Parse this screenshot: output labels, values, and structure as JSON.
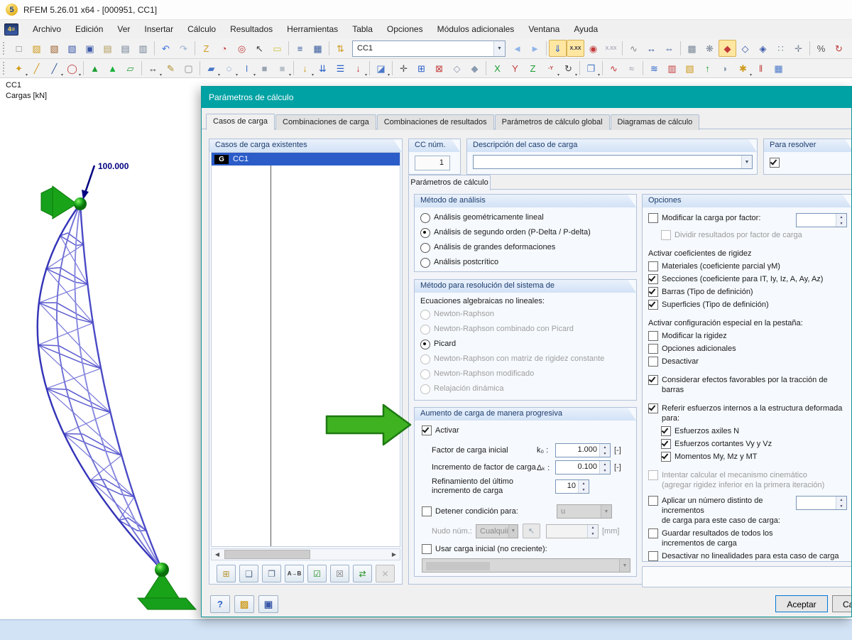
{
  "window": {
    "title": "RFEM 5.26.01 x64 - [000951, CC1]"
  },
  "menubar": {
    "items": [
      {
        "n": "menu-archivo",
        "label": "Archivo"
      },
      {
        "n": "menu-edicion",
        "label": "Edición"
      },
      {
        "n": "menu-ver",
        "label": "Ver"
      },
      {
        "n": "menu-insertar",
        "label": "Insertar"
      },
      {
        "n": "menu-calculo",
        "label": "Cálculo"
      },
      {
        "n": "menu-resultados",
        "label": "Resultados"
      },
      {
        "n": "menu-herramientas",
        "label": "Herramientas"
      },
      {
        "n": "menu-tabla",
        "label": "Tabla"
      },
      {
        "n": "menu-opciones",
        "label": "Opciones"
      },
      {
        "n": "menu-modulos-adicionales",
        "label": "Módulos adicionales"
      },
      {
        "n": "menu-ventana",
        "label": "Ventana"
      },
      {
        "n": "menu-ayuda",
        "label": "Ayuda"
      }
    ]
  },
  "toolbar1": {
    "combo_value": "CC1",
    "icons_before": [
      {
        "n": "new-model",
        "g": "□",
        "c": "#777"
      },
      {
        "n": "open-model",
        "g": "▨",
        "c": "#cf9b1c"
      },
      {
        "n": "open-project",
        "g": "▧",
        "c": "#a0622d"
      },
      {
        "n": "open-connection",
        "g": "▧",
        "c": "#3a58a8"
      },
      {
        "n": "save-model",
        "g": "▣",
        "c": "#3a58a8"
      },
      {
        "n": "clipboard",
        "g": "▤",
        "c": "#b09a5a"
      },
      {
        "n": "print",
        "g": "▤",
        "c": "#6f7f93"
      },
      {
        "n": "print-preview",
        "g": "▥",
        "c": "#6f7f93"
      },
      {
        "s": 1
      },
      {
        "n": "undo",
        "g": "↶",
        "c": "#3a6fd8"
      },
      {
        "n": "redo",
        "g": "↷",
        "c": "#9ab0d0"
      },
      {
        "s": 1
      },
      {
        "n": "new-polyline",
        "g": "Z",
        "c": "#cf9b1c"
      },
      {
        "n": "new-arc",
        "g": "◔",
        "c": "#c23b3b"
      },
      {
        "n": "new-circle",
        "g": "◎",
        "c": "#c23b3b"
      },
      {
        "n": "select-objects",
        "g": "↖",
        "c": "#444"
      },
      {
        "n": "new-block",
        "g": "▭",
        "c": "#cfc23a"
      },
      {
        "s": 1
      },
      {
        "n": "navigator-toggle",
        "g": "≡",
        "c": "#35599a"
      },
      {
        "n": "tables-toggle",
        "g": "▦",
        "c": "#35599a"
      },
      {
        "s": 1
      },
      {
        "n": "load-case-nav",
        "g": "⇅",
        "c": "#cf9b1c"
      }
    ],
    "icons_after": [
      {
        "n": "previous-load-case",
        "g": "◄",
        "c": "#8fb4e8"
      },
      {
        "n": "next-load-case",
        "g": "►",
        "c": "#8fb4e8"
      },
      {
        "s": 1
      },
      {
        "n": "show-loads",
        "g": "⇓",
        "c": "#2a62c8",
        "p": 1
      },
      {
        "n": "show-load-values",
        "g": "X.XX",
        "c": "#334",
        "p": 1,
        "sm": 1
      },
      {
        "n": "show-supports",
        "g": "◉",
        "c": "#c23b3b"
      },
      {
        "n": "show-result-values",
        "g": "X.XX",
        "c": "#aab",
        "sm": 1
      },
      {
        "s": 1
      },
      {
        "n": "member-couplings",
        "g": "∿",
        "c": "#8a8a8a"
      },
      {
        "n": "guide-lines",
        "g": "↔",
        "c": "#35599a"
      },
      {
        "n": "dimensions",
        "g": "⇔",
        "c": "#35599a"
      },
      {
        "s": 1
      },
      {
        "n": "fe-mesh",
        "g": "▩",
        "c": "#7d8a99"
      },
      {
        "n": "fe-mesh-settings",
        "g": "❋",
        "c": "#7d8a99"
      },
      {
        "n": "work-plane",
        "g": "◆",
        "c": "#c23b3b",
        "p": 1
      },
      {
        "n": "work-plane-xy",
        "g": "◇",
        "c": "#3a58a8"
      },
      {
        "n": "work-plane-xz",
        "g": "◈",
        "c": "#3a58a8"
      },
      {
        "n": "grid-points",
        "g": "∷",
        "c": "#7d8a99"
      },
      {
        "n": "snap-settings",
        "g": "✛",
        "c": "#7d8a99"
      },
      {
        "s": 1
      },
      {
        "n": "select-via-line",
        "g": "%",
        "c": "#555"
      },
      {
        "n": "rotate-copy",
        "g": "↻",
        "c": "#c23b3b"
      },
      {
        "n": "mirror-copy",
        "g": "⋈",
        "c": "#35599a"
      },
      {
        "n": "delete-objects",
        "g": "✕",
        "c": "#c23b3b"
      },
      {
        "n": "object-info",
        "g": "ⓘ",
        "c": "#2a62c8"
      },
      {
        "n": "display-properties",
        "g": "❏",
        "c": "#6f7f93"
      },
      {
        "n": "program-options",
        "g": "✱",
        "c": "#6f7f93"
      }
    ]
  },
  "toolbar2": {
    "icons": [
      {
        "n": "insert-node",
        "g": "✦",
        "c": "#cf9b1c",
        "d": 1
      },
      {
        "n": "insert-line",
        "g": "╱",
        "c": "#cf9b1c"
      },
      {
        "n": "insert-member",
        "g": "╱",
        "c": "#35599a",
        "d": 1
      },
      {
        "n": "insert-circle",
        "g": "◯",
        "c": "#c23b3b",
        "d": 1
      },
      {
        "s": 1
      },
      {
        "n": "nodal-support",
        "g": "▲",
        "c": "#1d9e33"
      },
      {
        "n": "line-support",
        "g": "▲",
        "c": "#19b33c"
      },
      {
        "n": "surface-support",
        "g": "▱",
        "c": "#1d9e33"
      },
      {
        "s": 1
      },
      {
        "n": "dimension",
        "g": "↔",
        "c": "#444",
        "d": 1
      },
      {
        "n": "comment",
        "g": "✎",
        "c": "#b08c2a"
      },
      {
        "n": "select-box",
        "g": "▢",
        "c": "#888"
      },
      {
        "s": 1
      },
      {
        "n": "new-surface",
        "g": "▰",
        "c": "#4a78c8",
        "d": 1
      },
      {
        "n": "new-opening",
        "g": "◌",
        "c": "#4a78c8",
        "d": 1
      },
      {
        "n": "new-rib",
        "g": "I",
        "c": "#4a78c8",
        "d": 1
      },
      {
        "n": "new-solid",
        "g": "■",
        "c": "#9aa4b0"
      },
      {
        "n": "new-solid-via-surfaces",
        "g": "■",
        "c": "#b8c0ca",
        "d": 1
      },
      {
        "s": 1
      },
      {
        "n": "nodal-load",
        "g": "↓",
        "c": "#cf9b1c",
        "d": 1
      },
      {
        "n": "member-load",
        "g": "⇊",
        "c": "#2a62c8"
      },
      {
        "n": "surface-load",
        "g": "☰",
        "c": "#2a62c8"
      },
      {
        "n": "free-load",
        "g": "↓",
        "c": "#c23b3b",
        "d": 1
      },
      {
        "s": 1
      },
      {
        "n": "load-generation",
        "g": "◪",
        "c": "#4a78c8",
        "d": 1
      },
      {
        "s": 1
      },
      {
        "n": "special-selection",
        "g": "✛",
        "c": "#555"
      },
      {
        "n": "zoom-window",
        "g": "⊞",
        "c": "#2a62c8"
      },
      {
        "n": "zoom-out",
        "g": "⊠",
        "c": "#c23b3b"
      },
      {
        "n": "isometric-view",
        "g": "◇",
        "c": "#8a9ab0"
      },
      {
        "n": "perspective-view",
        "g": "◆",
        "c": "#8a9ab0"
      },
      {
        "s": 1
      },
      {
        "n": "view-x",
        "g": "X",
        "c": "#1d9e33"
      },
      {
        "n": "view-y",
        "g": "Y",
        "c": "#c23b3b"
      },
      {
        "n": "view-z",
        "g": "Z",
        "c": "#1d9e33"
      },
      {
        "n": "view-minus-y",
        "g": "-Y",
        "c": "#c23b3b",
        "d": 1,
        "sm": 1
      },
      {
        "n": "rotate-view",
        "g": "↻",
        "c": "#444",
        "d": 1
      },
      {
        "s": 1
      },
      {
        "n": "visibility-modes",
        "g": "❐",
        "c": "#4a78c8",
        "d": 1
      },
      {
        "s": 1
      },
      {
        "n": "show-deformation",
        "g": "∿",
        "c": "#c23b3b"
      },
      {
        "n": "panel-toggle",
        "g": "≈",
        "c": "#99a"
      },
      {
        "s": 1
      },
      {
        "n": "results-diagrams",
        "g": "≋",
        "c": "#2a62c8"
      },
      {
        "n": "color-panels",
        "g": "▥",
        "c": "#c23b3b"
      },
      {
        "n": "render-model",
        "g": "▧",
        "c": "#cf9b1c"
      },
      {
        "n": "deformed-shape",
        "g": "↑",
        "c": "#1d9e33"
      },
      {
        "n": "smooth-results",
        "g": "◗",
        "c": "#8a9ab0"
      },
      {
        "n": "result-values",
        "g": "✱",
        "c": "#cf9b1c",
        "d": 1
      },
      {
        "n": "sections",
        "g": "‖",
        "c": "#c23b3b"
      },
      {
        "n": "result-tables",
        "g": "▦",
        "c": "#4a78c8"
      }
    ]
  },
  "viewport": {
    "case_label": "CC1",
    "subtitle": "Cargas [kN]",
    "load_value": "100.000"
  },
  "dialog": {
    "title": "Parámetros de cálculo",
    "tabs": [
      {
        "n": "tab-casos-de-carga",
        "label": "Casos de carga",
        "active": 1
      },
      {
        "n": "tab-combinaciones-de-carga",
        "label": "Combinaciones de carga"
      },
      {
        "n": "tab-combinaciones-de-resultados",
        "label": "Combinaciones de resultados"
      },
      {
        "n": "tab-parametros-calculo-global",
        "label": "Parámetros de cálculo global"
      },
      {
        "n": "tab-diagramas-de-calculo",
        "label": "Diagramas de cálculo"
      }
    ],
    "cases_panel": {
      "header": "Casos de carga existentes",
      "badge": "G",
      "case_name": "CC1"
    },
    "case_buttons": [
      {
        "n": "new-load-case",
        "g": "⊞",
        "c": "#b8932e"
      },
      {
        "n": "copy-load-case",
        "g": "❏",
        "c": "#556a88"
      },
      {
        "n": "copy-load-case-to",
        "g": "❐",
        "c": "#556a88"
      },
      {
        "n": "rename-load-case",
        "g": "A→B",
        "c": "#333",
        "sm": 1
      },
      {
        "n": "activate-all-cases",
        "g": "☑",
        "c": "#1d8f1d"
      },
      {
        "n": "deactivate-all-cases",
        "g": "☒",
        "c": "#777"
      },
      {
        "n": "toggle-case-activation",
        "g": "⇄",
        "c": "#1d8f1d"
      },
      {
        "n": "delete-load-case",
        "g": "✕",
        "c": "#b5b5b5",
        "dis": 1,
        "last": 1
      }
    ],
    "cc_num": {
      "header": "CC núm.",
      "value": "1"
    },
    "description": {
      "header": "Descripción del caso de carga",
      "value": ""
    },
    "to_solve": {
      "header": "Para resolver",
      "checked": true
    },
    "inner_tab": "Parámetros de cálculo",
    "method": {
      "header": "Método de análisis",
      "items": [
        {
          "n": "analysis-geometric-linear",
          "l": "Análisis geométricamente lineal"
        },
        {
          "n": "analysis-second-order",
          "l": "Análisis de segundo orden (P-Delta / P-delta)",
          "sel": 1
        },
        {
          "n": "analysis-large-deformations",
          "l": "Análisis de grandes deformaciones"
        },
        {
          "n": "analysis-postcritical",
          "l": "Análisis postcrítico"
        }
      ]
    },
    "solver": {
      "header": "Método para resolución del sistema de",
      "note": "Ecuaciones algebraicas no lineales:",
      "items": [
        {
          "n": "solver-newton-raphson",
          "l": "Newton-Raphson",
          "dis": 1
        },
        {
          "n": "solver-newton-raphson-picard",
          "l": "Newton-Raphson combinado con Picard",
          "dis": 1
        },
        {
          "n": "solver-picard",
          "l": "Picard",
          "sel": 1
        },
        {
          "n": "solver-nr-constant-stiffness",
          "l": "Newton-Raphson con matriz de rigidez constante",
          "dis": 1
        },
        {
          "n": "solver-nr-modified",
          "l": "Newton-Raphson modificado",
          "dis": 1
        },
        {
          "n": "solver-dynamic-relaxation",
          "l": "Relajación dinámica",
          "dis": 1
        }
      ]
    },
    "incremental": {
      "header": "Aumento de carga de manera progresiva",
      "activate_label": "Activar",
      "rows": [
        {
          "label": "Factor de carga inicial",
          "sym": "k₀ :",
          "value": "1.000",
          "unit": "[-]"
        },
        {
          "label": "Incremento de factor de carga",
          "sym": "Δₖ :",
          "value": "0.100",
          "unit": "[-]"
        },
        {
          "label": "Refinamiento del último incremento de carga",
          "value": "10"
        }
      ],
      "stop_label": "Detener condición para:",
      "stop_value": "u",
      "node_label": "Nudo núm.:",
      "node_value": "Cualquii",
      "node_unit": "[mm]",
      "initial_label": "Usar carga inicial (no creciente):"
    },
    "options": {
      "header": "Opciones",
      "items": [
        {
          "t": "check",
          "n": "modify-load-factor",
          "l": "Modificar la carga por factor:",
          "sp": 1
        },
        {
          "t": "check",
          "n": "divide-results-by-factor",
          "l": "Dividir resultados por factor de carga",
          "dis": 1,
          "ind": 1
        },
        {
          "t": "label",
          "n": "stiffness-coefficients-label",
          "l": "Activar coeficientes de rigidez",
          "gap": 8
        },
        {
          "t": "check",
          "n": "materials-partial-coefficient",
          "l": "Materiales (coeficiente parcial γM)"
        },
        {
          "t": "check",
          "n": "sections-coefficient",
          "l": "Secciones (coeficiente para IT, Iy, Iz, A, Ay, Az)",
          "ck": 1
        },
        {
          "t": "check",
          "n": "members-definition-type",
          "l": "Barras (Tipo de definición)",
          "ck": 1
        },
        {
          "t": "check",
          "n": "surfaces-definition-type",
          "l": "Superficies (Tipo de definición)",
          "ck": 1
        },
        {
          "t": "label",
          "n": "special-settings-label",
          "l": "Activar configuración especial en la pestaña:",
          "gap": 8
        },
        {
          "t": "check",
          "n": "modify-stiffness",
          "l": "Modificar la rigidez"
        },
        {
          "t": "check",
          "n": "additional-options",
          "l": "Opciones adicionales"
        },
        {
          "t": "check",
          "n": "deactivate-tab",
          "l": "Desactivar"
        },
        {
          "t": "check",
          "n": "favorable-tension-effects",
          "l": "Considerar efectos favorables por la tracción de barras",
          "ck": 1,
          "gap": 8
        },
        {
          "t": "check",
          "n": "refer-internal-forces-deformed",
          "l": "Referir esfuerzos internos a la estructura deformada\npara:",
          "ck": 1,
          "gap": 8
        },
        {
          "t": "check",
          "n": "axial-forces-n",
          "l": "Esfuerzos axiles N",
          "ck": 1,
          "ind": 1
        },
        {
          "t": "check",
          "n": "shear-forces-vy-vz",
          "l": "Esfuerzos cortantes Vy y Vz",
          "ck": 1,
          "ind": 1
        },
        {
          "t": "check",
          "n": "moments-my-mz-mt",
          "l": "Momentos My, Mz y MT",
          "ck": 1,
          "ind": 1
        },
        {
          "t": "check",
          "n": "kinematic-mechanism",
          "l": "Intentar calcular el mecanismo cinemático\n(agregar rigidez inferior en la primera iteración)",
          "dis": 1,
          "gap": 8
        },
        {
          "t": "check",
          "n": "separate-load-increments",
          "l": "Aplicar un número distinto de incrementos\nde carga para este caso de carga:",
          "sp": 1,
          "gap": 4
        },
        {
          "t": "check",
          "n": "save-all-increments",
          "l": "Guardar resultados de todos los\nincrementos de carga"
        },
        {
          "t": "check",
          "n": "deactivate-nonlinearities",
          "l": "Desactivar no linealidades para esta caso de carga"
        }
      ]
    },
    "footer_buttons": [
      {
        "n": "help-button",
        "g": "?",
        "c": "#2a62c8"
      },
      {
        "n": "open-settings-button",
        "g": "▨",
        "c": "#cf9b1c"
      },
      {
        "n": "save-settings-button",
        "g": "▣",
        "c": "#3a58a8"
      }
    ],
    "footer": {
      "accept": "Aceptar",
      "cancel": "Ca"
    }
  }
}
